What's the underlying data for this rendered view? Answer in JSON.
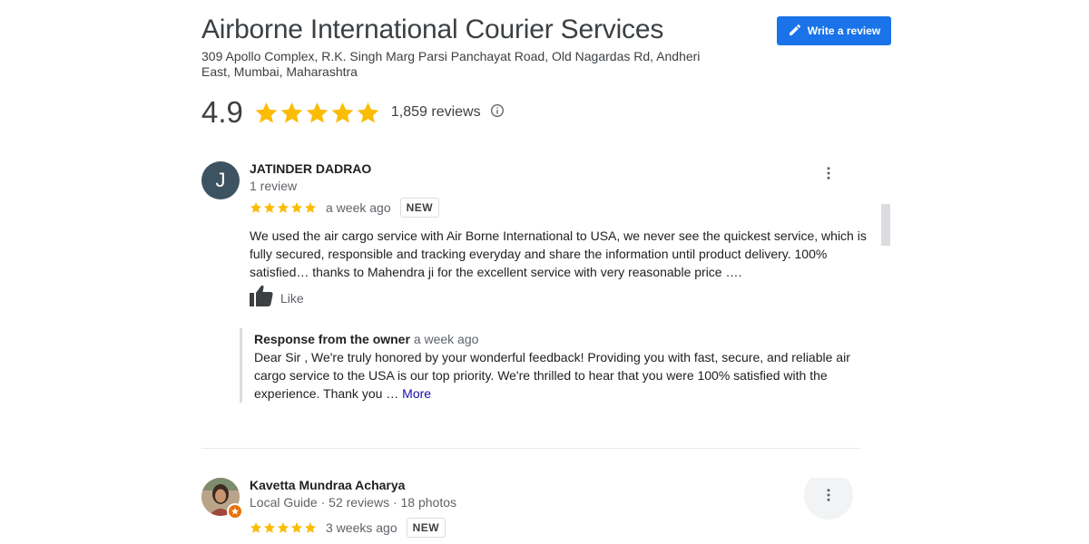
{
  "business": {
    "name": "Airborne International Courier Services",
    "address": "309 Apollo Complex, R.K. Singh Marg Parsi Panchayat Road, Old Nagardas Rd, Andheri East, Mumbai, Maharashtra",
    "rating": "4.9",
    "rating_stars": 5,
    "review_count": "1,859 reviews",
    "write_review_label": "Write a review"
  },
  "colors": {
    "star": "#fbbc04",
    "accent": "#1a73e8",
    "more_link": "#1a0dab"
  },
  "reviews": [
    {
      "avatar_letter": "J",
      "name": "JATINDER DADRAO",
      "meta": "1 review",
      "stars": 5,
      "time": "a week ago",
      "badge": "NEW",
      "text": "We used the air cargo service with Air Borne International to USA, we never see the quickest service, which is fully secured, responsible and tracking everyday and share the information until product delivery. 100% satisfied… thanks to Mahendra ji for the excellent service with very reasonable price ….",
      "like_label": "Like",
      "owner_response": {
        "label": "Response from the owner",
        "time": "a week ago",
        "text": "Dear Sir , We're truly honored by your wonderful feedback! Providing you with fast, secure, and reliable air cargo service to the USA is our top priority. We're thrilled to hear that you were 100% satisfied with the experience. Thank you …",
        "more_label": "More"
      }
    },
    {
      "name": "Kavetta Mundraa Acharya",
      "meta": "Local Guide · 52 reviews · 18 photos",
      "stars": 5,
      "time": "3 weeks ago",
      "badge": "NEW"
    }
  ],
  "icons": [
    "edit-icon",
    "star-icon",
    "info-icon",
    "more-vert-icon",
    "thumb-up-icon",
    "local-guide-icon"
  ]
}
